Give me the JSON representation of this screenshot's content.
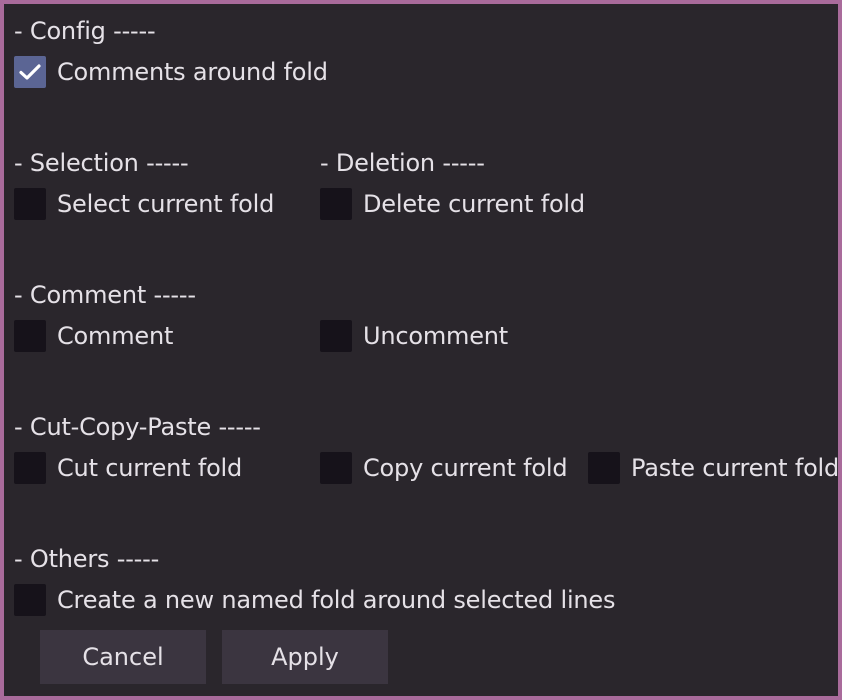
{
  "sections": {
    "config": {
      "heading": "- Config -----",
      "comments_around_fold": {
        "label": "Comments around fold",
        "checked": true
      }
    },
    "selection": {
      "heading": "- Selection -----",
      "select_current_fold": {
        "label": "Select current fold",
        "checked": false
      }
    },
    "deletion": {
      "heading": "- Deletion -----",
      "delete_current_fold": {
        "label": "Delete current fold",
        "checked": false
      }
    },
    "comment": {
      "heading": "- Comment -----",
      "comment": {
        "label": "Comment",
        "checked": false
      },
      "uncomment": {
        "label": "Uncomment",
        "checked": false
      }
    },
    "cut_copy_paste": {
      "heading": "- Cut-Copy-Paste -----",
      "cut_current_fold": {
        "label": "Cut current fold",
        "checked": false
      },
      "copy_current_fold": {
        "label": "Copy current fold",
        "checked": false
      },
      "paste_current_fold": {
        "label": "Paste current fold",
        "checked": false
      }
    },
    "others": {
      "heading": "- Others -----",
      "create_named_fold": {
        "label": "Create a new named fold around selected lines",
        "checked": false
      }
    }
  },
  "buttons": {
    "cancel": "Cancel",
    "apply": "Apply"
  },
  "colors": {
    "window_border": "#a96b9b",
    "background": "#2a262c",
    "checkbox_unchecked": "#16121a",
    "checkbox_checked": "#5b6594",
    "button_background": "#3b3540",
    "text": "#e5e1e7"
  },
  "icons": {
    "checkmark": "check-icon"
  }
}
